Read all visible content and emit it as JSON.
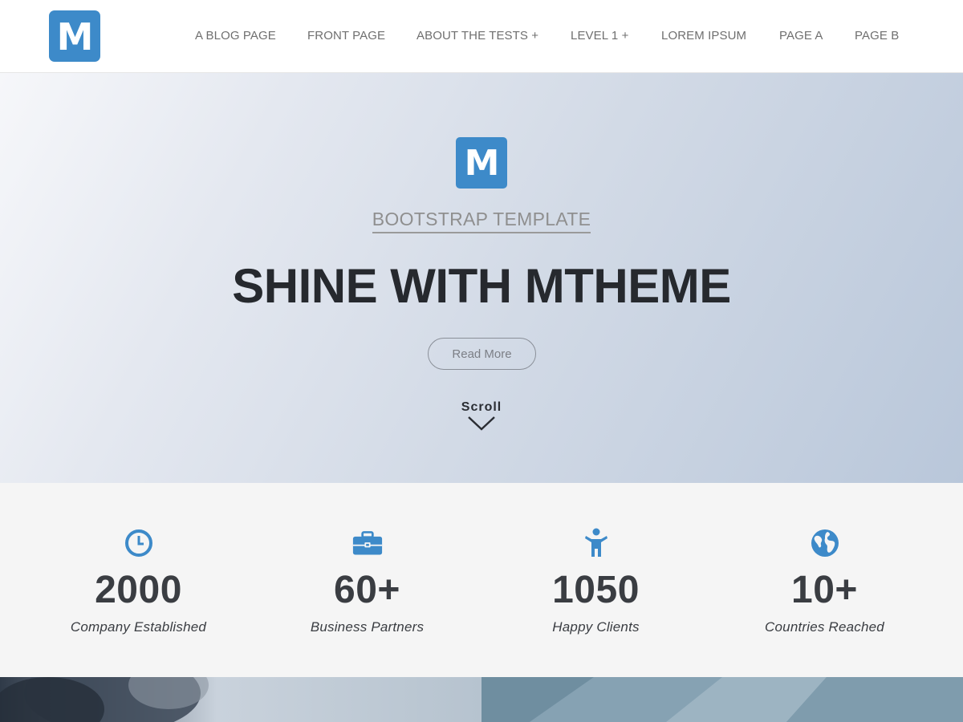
{
  "header": {
    "logo_letter": "M",
    "nav": [
      {
        "label": "A BLOG PAGE"
      },
      {
        "label": "FRONT PAGE"
      },
      {
        "label": "ABOUT THE TESTS +"
      },
      {
        "label": "LEVEL 1 +"
      },
      {
        "label": "LOREM IPSUM"
      },
      {
        "label": "PAGE A"
      },
      {
        "label": "PAGE B"
      }
    ]
  },
  "hero": {
    "logo_letter": "M",
    "subtitle": "BOOTSTRAP TEMPLATE",
    "title": "SHINE WITH MTHEME",
    "button_label": "Read More",
    "scroll_label": "Scroll"
  },
  "stats": [
    {
      "icon": "clock-icon",
      "value": "2000",
      "label": "Company Established"
    },
    {
      "icon": "briefcase-icon",
      "value": "60+",
      "label": "Business Partners"
    },
    {
      "icon": "person-icon",
      "value": "1050",
      "label": "Happy Clients"
    },
    {
      "icon": "globe-icon",
      "value": "10+",
      "label": "Countries Reached"
    }
  ],
  "colors": {
    "accent": "#3d8ac9",
    "nav_text": "#6f6f6f",
    "title_text": "#26292e",
    "stats_background": "#f5f5f5"
  }
}
